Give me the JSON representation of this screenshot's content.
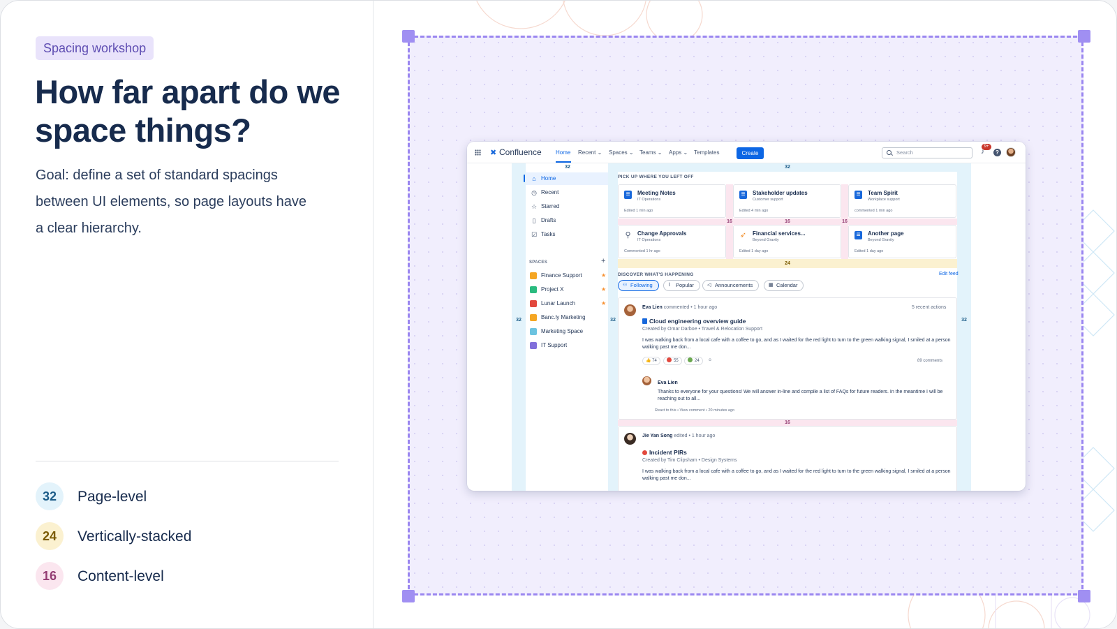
{
  "left": {
    "tag": "Spacing workshop",
    "title": "How far apart do we space things?",
    "goal": "Goal: define a set of standard spacings between UI elements, so page layouts have a clear hierarchy.",
    "legend": [
      {
        "value": "32",
        "label": "Page-level"
      },
      {
        "value": "24",
        "label": "Vertically-stacked"
      },
      {
        "value": "16",
        "label": "Content-level"
      }
    ]
  },
  "colors": {
    "accent": "#9a86f0",
    "page_level": "#e3f3fb",
    "stacked": "#fbf1d0",
    "content": "#fbe6ef",
    "brand": "#0c66e4"
  },
  "app": {
    "logo": "Confluence",
    "nav": {
      "home": "Home",
      "recent": "Recent ⌄",
      "spaces": "Spaces ⌄",
      "teams": "Teams ⌄",
      "apps": "Apps ⌄",
      "templates": "Templates"
    },
    "create": "Create",
    "search_placeholder": "Search",
    "notification_badge": "9+",
    "sidebar": {
      "items": [
        {
          "label": "Home",
          "icon": "home-icon"
        },
        {
          "label": "Recent",
          "icon": "clock-icon"
        },
        {
          "label": "Starred",
          "icon": "star-icon"
        },
        {
          "label": "Drafts",
          "icon": "draft-icon"
        },
        {
          "label": "Tasks",
          "icon": "task-icon"
        }
      ],
      "spaces_heading": "SPACES",
      "spaces": [
        {
          "label": "Finance Support",
          "color": "#f5a623",
          "starred": true
        },
        {
          "label": "Project X",
          "color": "#2abb7f",
          "starred": true
        },
        {
          "label": "Lunar Launch",
          "color": "#e2483d",
          "starred": true
        },
        {
          "label": "Banc.ly Marketing",
          "color": "#f5a623",
          "starred": false
        },
        {
          "label": "Marketing Space",
          "color": "#6cc3e0",
          "starred": false
        },
        {
          "label": "IT Support",
          "color": "#8270db",
          "starred": false
        }
      ]
    },
    "pickup_title": "PICK UP WHERE YOU LEFT OFF",
    "cards": [
      {
        "title": "Meeting Notes",
        "sub": "IT Operations",
        "meta": "Edited 1 min ago",
        "icon": "page-icon"
      },
      {
        "title": "Stakeholder updates",
        "sub": "Customer support",
        "meta": "Edited 4 min ago",
        "icon": "page-icon"
      },
      {
        "title": "Team Spirit",
        "sub": "Workplace support",
        "meta": "commented 1 min ago",
        "icon": "page-icon"
      },
      {
        "title": "Change Approvals",
        "sub": "IT Operations",
        "meta": "Commented 1 hr ago",
        "icon": "satellite-icon"
      },
      {
        "title": "Financial services...",
        "sub": "Beyond Gravity",
        "meta": "Edited 1 day ago",
        "icon": "rocket-icon"
      },
      {
        "title": "Another page",
        "sub": "Beyond Gravity",
        "meta": "Edited 1 day ago",
        "icon": "page-icon"
      }
    ],
    "discover_title": "DISCOVER WHAT'S HAPPENING",
    "edit_feed": "Edit feed",
    "tabs": [
      "Following",
      "Popular",
      "Announcements",
      "Calendar"
    ],
    "feed": [
      {
        "author": "Eva Lien",
        "action": "commented",
        "time": "• 1 hour ago",
        "recent": "5 recent actions",
        "title": "Cloud engineering overview guide",
        "created": "Created by Omar Darboe  •  Travel & Relocation Support",
        "excerpt": "I was walking back from a local cafe with a coffee to go, and as I waited for the red light to turn to the green walking signal, I smiled at a person walking past me don...",
        "reactions": [
          "👍 74",
          "55",
          "24",
          "☺"
        ],
        "comments": "89 comments",
        "reply": {
          "author": "Eva Lien",
          "text": "Thanks to everyone for your questions! We will answer in-line and compile a list of FAQs for future readers. In the meantime I will be reaching out to all...",
          "meta": "React to this  •  View comment  •  20 minutes ago"
        }
      },
      {
        "author": "Jie Yan Song",
        "action": "edited",
        "time": "• 1 hour ago",
        "title": "Incident PIRs",
        "created": "Created by Tim Clipsham  •  Design Systems",
        "excerpt": "I was walking back from a local cafe with a coffee to go, and as I waited for the red light to turn to the green walking signal, I smiled at a person walking past me don..."
      }
    ],
    "spacing_labels": {
      "page": "32",
      "stack": "24",
      "content": "16"
    }
  }
}
